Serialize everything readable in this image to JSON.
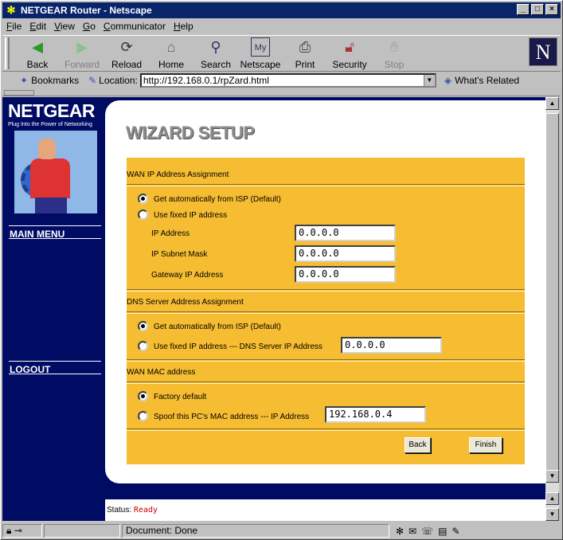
{
  "window": {
    "title": "NETGEAR Router - Netscape"
  },
  "menu": [
    "File",
    "Edit",
    "View",
    "Go",
    "Communicator",
    "Help"
  ],
  "toolbar": [
    {
      "label": "Back",
      "icon": "back-arrow-icon",
      "enabled": true
    },
    {
      "label": "Forward",
      "icon": "forward-arrow-icon",
      "enabled": false
    },
    {
      "label": "Reload",
      "icon": "reload-icon",
      "enabled": true
    },
    {
      "label": "Home",
      "icon": "home-icon",
      "enabled": true
    },
    {
      "label": "Search",
      "icon": "search-icon",
      "enabled": true
    },
    {
      "label": "Netscape",
      "icon": "netscape-icon",
      "enabled": true
    },
    {
      "label": "Print",
      "icon": "print-icon",
      "enabled": true
    },
    {
      "label": "Security",
      "icon": "lock-icon",
      "enabled": true
    },
    {
      "label": "Stop",
      "icon": "stop-icon",
      "enabled": false
    }
  ],
  "location": {
    "bookmarks_label": "Bookmarks",
    "location_label": "Location:",
    "url": "http://192.168.0.1/rpZard.html",
    "whats_related": "What's Related"
  },
  "sidebar": {
    "logo": "NETGEAR",
    "tagline": "Plug Into the Power of Networking",
    "main_menu": "MAIN MENU",
    "logout": "LOGOUT"
  },
  "page": {
    "title": "WIZARD SETUP",
    "wan_ip": {
      "heading": "WAN IP Address Assignment",
      "option_auto": "Get automatically from ISP (Default)",
      "option_fixed": "Use fixed IP address",
      "selected": "auto",
      "ip_label": "IP Address",
      "ip_value": "0.0.0.0",
      "mask_label": "IP Subnet Mask",
      "mask_value": "0.0.0.0",
      "gateway_label": "Gateway IP Address",
      "gateway_value": "0.0.0.0"
    },
    "dns": {
      "heading": "DNS Server Address Assignment",
      "option_auto": "Get automatically from ISP (Default)",
      "option_fixed": "Use fixed IP address --- DNS Server IP Address",
      "selected": "auto",
      "dns_value": "0.0.0.0"
    },
    "mac": {
      "heading": "WAN MAC address",
      "option_default": "Factory default",
      "option_spoof": "Spoof this PC's MAC address --- IP Address",
      "selected": "default",
      "spoof_ip_value": "192.168.0.4"
    },
    "buttons": {
      "back": "Back",
      "finish": "Finish"
    }
  },
  "status_frame": {
    "label": "Status:",
    "value": "Ready"
  },
  "statusbar": {
    "text": "Document: Done"
  },
  "colors": {
    "form_bg": "#f6bd32",
    "sidebar_bg": "#000b64",
    "title_bar": "#0a246a",
    "status_ready": "#cc0000"
  }
}
